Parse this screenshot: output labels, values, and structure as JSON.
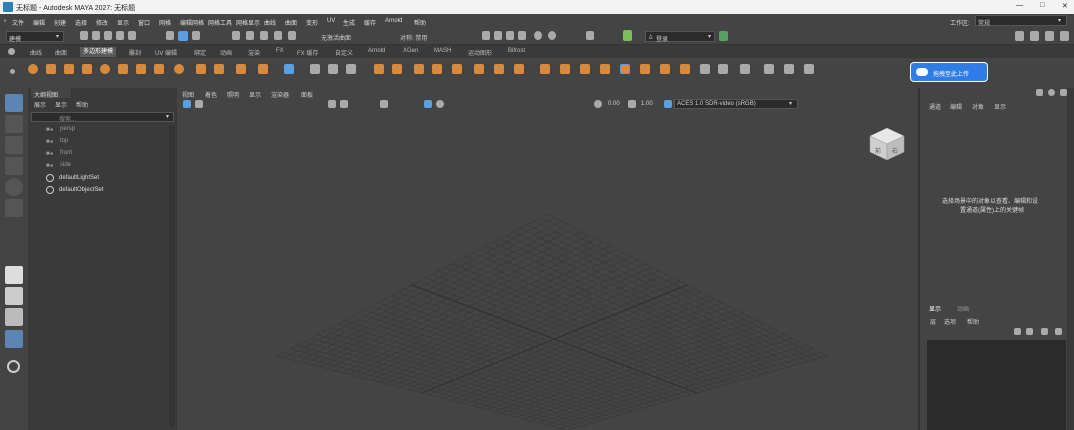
{
  "title_bar": {
    "app_title": "无标题 - Autodesk MAYA 2027: 无标题",
    "minimize": "—",
    "maximize": "□",
    "close": "✕"
  },
  "menu": {
    "items": [
      "文件",
      "编辑",
      "创建",
      "选择",
      "修改",
      "显示",
      "窗口",
      "网格",
      "编辑网格",
      "网格工具",
      "网格显示",
      "曲线",
      "曲面",
      "变形",
      "UV",
      "生成",
      "缓存",
      "Arnold",
      "帮助"
    ],
    "workspace_label": "工作区:",
    "workspace_value": "常规"
  },
  "status_line": {
    "mode_value": "建模",
    "no_live_surface": "无激活曲面",
    "symmetry": "对称: 禁用",
    "login": "登录"
  },
  "shelf": {
    "tabs": [
      "曲线",
      "曲面",
      "多边形建模",
      "雕刻",
      "UV 编辑",
      "绑定",
      "动画",
      "渲染",
      "FX",
      "FX 缓存",
      "自定义",
      "Arnold",
      "XGen",
      "MASH",
      "运动图形",
      "Bifrost"
    ],
    "active_tab": "多边形建模",
    "upload_button": "拖拽至此上传"
  },
  "outliner": {
    "title": "大纲视图",
    "menus": [
      "展示",
      "显示",
      "帮助"
    ],
    "search_placeholder": "搜索...",
    "items": [
      "persp",
      "top",
      "front",
      "side",
      "defaultLightSet",
      "defaultObjectSet"
    ]
  },
  "viewport": {
    "menus": [
      "视图",
      "着色",
      "照明",
      "显示",
      "渲染器",
      "面板"
    ],
    "exposure": "0.00",
    "gamma": "1.00",
    "colorspace": "ACES 1.0 SDR-video (sRGB)",
    "viewcube_front": "前",
    "viewcube_right": "右"
  },
  "attr_panel": {
    "menus": [
      "通道",
      "编辑",
      "对象",
      "显示"
    ],
    "hint_line1": "选择场景中的对象以查看、编辑和设",
    "hint_line2": "置通道(属性)上的关键帧"
  },
  "layer_panel": {
    "tabs": [
      "显示",
      "动画"
    ],
    "menus": [
      "层",
      "选项",
      "帮助"
    ]
  }
}
